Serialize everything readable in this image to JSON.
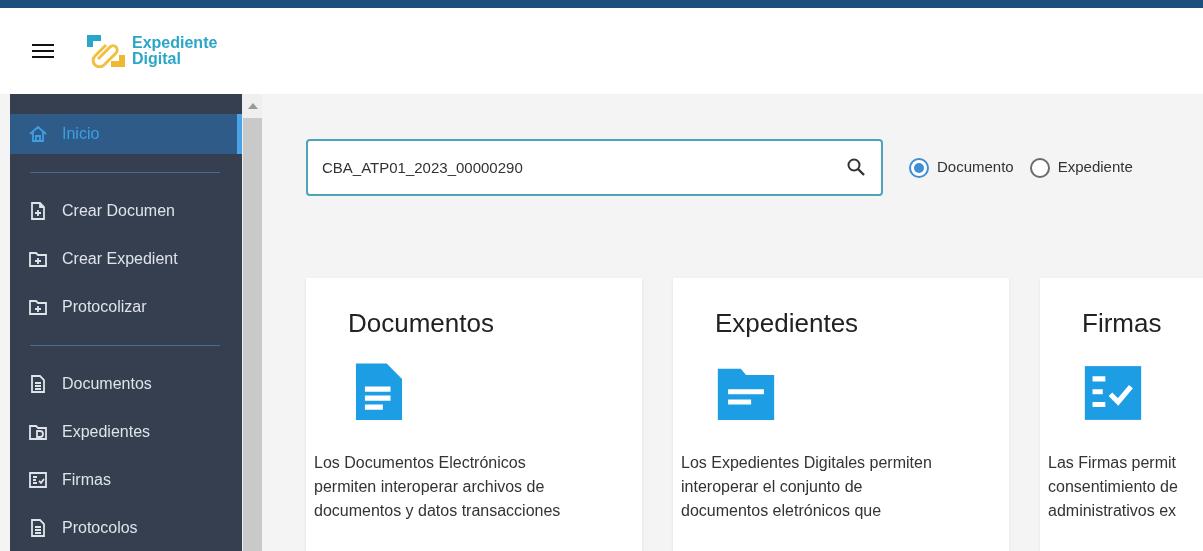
{
  "header": {
    "logo_line1": "Expediente",
    "logo_line2": "Digital"
  },
  "sidebar": {
    "groups": [
      [
        {
          "label": "Inicio",
          "selected": true
        }
      ],
      [
        {
          "label": "Crear Documen",
          "selected": false
        },
        {
          "label": "Crear Expedient",
          "selected": false
        },
        {
          "label": "Protocolizar",
          "selected": false
        }
      ],
      [
        {
          "label": "Documentos",
          "selected": false
        },
        {
          "label": "Expedientes",
          "selected": false
        },
        {
          "label": "Firmas",
          "selected": false
        },
        {
          "label": "Protocolos",
          "selected": false
        }
      ]
    ]
  },
  "search": {
    "value": "CBA_ATP01_2023_00000290"
  },
  "search_type": [
    {
      "label": "Documento",
      "selected": true
    },
    {
      "label": "Expediente",
      "selected": false
    }
  ],
  "cards": [
    {
      "title": "Documentos",
      "lines": [
        "Los Documentos Electrónicos",
        "permiten interoperar archivos de",
        "documentos y datos transacciones"
      ]
    },
    {
      "title": "Expedientes",
      "lines": [
        "Los Expedientes Digitales permiten",
        "interoperar el conjunto de",
        "documentos eletrónicos que"
      ]
    },
    {
      "title": "Firmas",
      "lines": [
        "Las Firmas permit",
        "consentimiento de",
        "administrativos ex"
      ]
    }
  ]
}
